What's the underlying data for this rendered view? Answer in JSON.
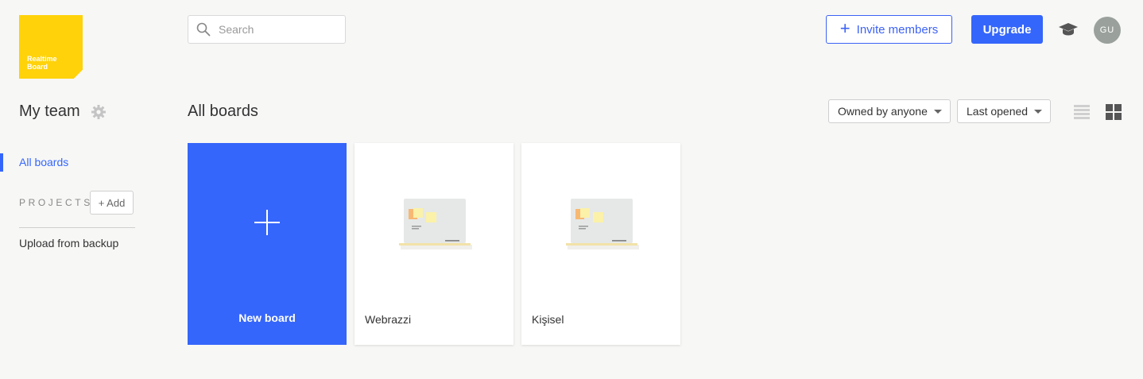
{
  "brand": {
    "line1": "Realtime",
    "line2": "Board",
    "color": "#ffd20a"
  },
  "header": {
    "search_placeholder": "Search",
    "invite_label": "Invite members",
    "upgrade_label": "Upgrade",
    "avatar_initials": "GU",
    "accent": "#3566fb"
  },
  "sidebar": {
    "team_title": "My team",
    "nav_all_boards": "All boards",
    "projects_label": "PROJECTS",
    "add_label": "+ Add",
    "upload_label": "Upload from backup"
  },
  "main": {
    "title": "All boards",
    "filter_owner": "Owned by anyone",
    "filter_sort": "Last opened",
    "view_modes": [
      "list-view-icon",
      "grid-view-icon"
    ],
    "active_view": "grid"
  },
  "boards": {
    "new_label": "New board",
    "items": [
      {
        "name": "Webrazzi"
      },
      {
        "name": "Kişisel"
      }
    ]
  }
}
